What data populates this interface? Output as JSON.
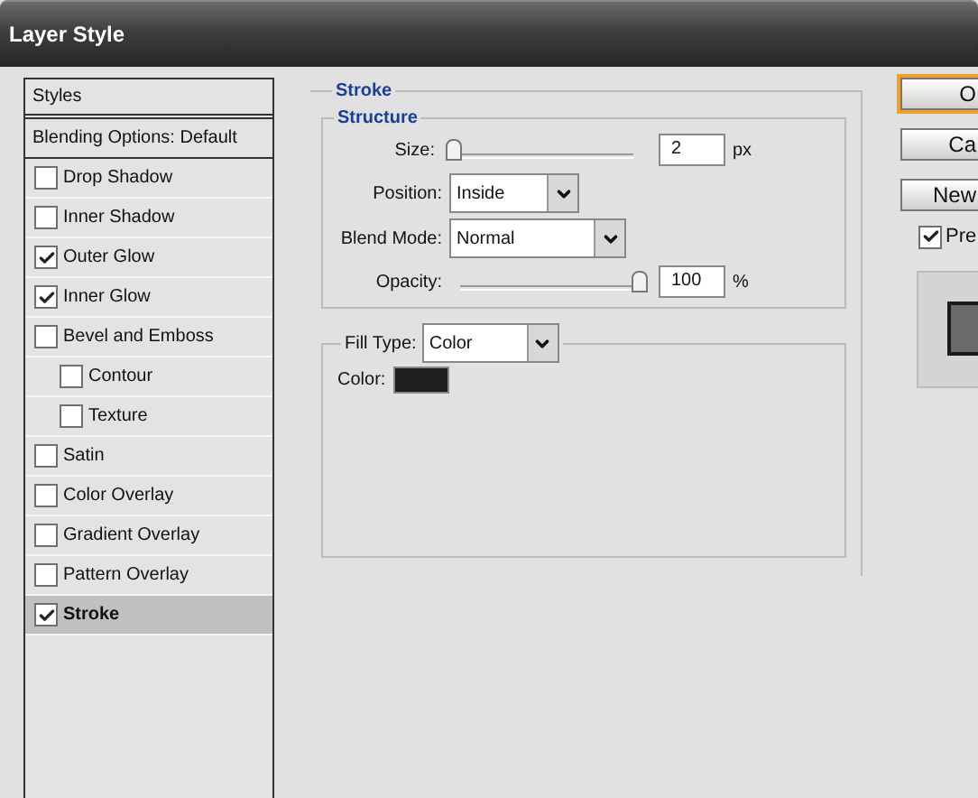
{
  "window": {
    "title": "Layer Style"
  },
  "sidebar": {
    "header": "Styles",
    "blending": "Blending Options: Default",
    "items": [
      {
        "label": "Drop Shadow",
        "checked": false,
        "selected": false
      },
      {
        "label": "Inner Shadow",
        "checked": false,
        "selected": false
      },
      {
        "label": "Outer Glow",
        "checked": true,
        "selected": false
      },
      {
        "label": "Inner Glow",
        "checked": true,
        "selected": false
      },
      {
        "label": "Bevel and Emboss",
        "checked": false,
        "selected": false,
        "children": [
          {
            "label": "Contour",
            "checked": false,
            "selected": false
          },
          {
            "label": "Texture",
            "checked": false,
            "selected": false
          }
        ]
      },
      {
        "label": "Satin",
        "checked": false,
        "selected": false
      },
      {
        "label": "Color Overlay",
        "checked": false,
        "selected": false
      },
      {
        "label": "Gradient Overlay",
        "checked": false,
        "selected": false
      },
      {
        "label": "Pattern Overlay",
        "checked": false,
        "selected": false
      },
      {
        "label": "Stroke",
        "checked": true,
        "selected": true
      }
    ]
  },
  "panel": {
    "title": "Stroke",
    "structure": {
      "title": "Structure",
      "size": {
        "label": "Size:",
        "level": 0,
        "value": "2",
        "unit": "px"
      },
      "position": {
        "label": "Position:",
        "value": "Inside"
      },
      "blend_mode": {
        "label": "Blend Mode:",
        "value": "Normal"
      },
      "opacity": {
        "label": "Opacity:",
        "level": 1,
        "value": "100",
        "unit": "%"
      }
    },
    "fill": {
      "label": "Fill Type:",
      "value": "Color",
      "color_label": "Color:",
      "color": "#1e1e1e"
    }
  },
  "buttons": [
    {
      "label": "O",
      "default": true
    },
    {
      "label": "Ca",
      "default": false
    },
    {
      "label": "New",
      "default": false
    }
  ],
  "preview": {
    "label": "Pre",
    "checked": true
  }
}
